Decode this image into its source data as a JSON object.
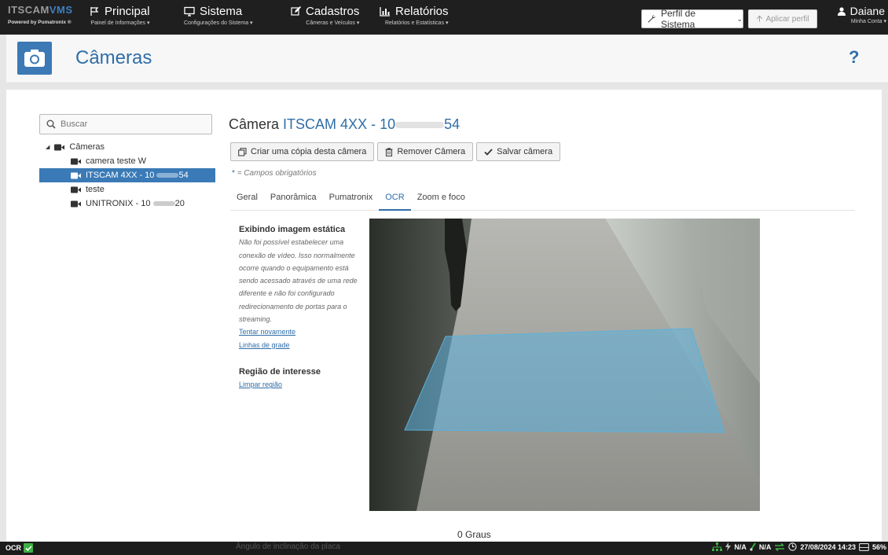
{
  "brand": {
    "logo_text_a": "ITSCAM",
    "logo_text_b": "VMS",
    "powered": "Powered by Pumatronix ®"
  },
  "nav": [
    {
      "label": "Principal",
      "sub": "Painel de Informações ▾",
      "icon": "flag-icon"
    },
    {
      "label": "Sistema",
      "sub": "Configurações do Sistema ▾",
      "icon": "monitor-icon"
    },
    {
      "label": "Cadastros",
      "sub": "Câmeras e Veículos ▾",
      "icon": "edit-icon"
    },
    {
      "label": "Relatórios",
      "sub": "Relatórios e Estatísticas ▾",
      "icon": "bar-chart-icon"
    }
  ],
  "profile": {
    "label": "Perfil de Sistema",
    "apply": "Aplicar perfil"
  },
  "user": {
    "name": "Daiane",
    "sub": "Minha Conta ▾"
  },
  "page": {
    "title": "Câmeras",
    "help": "?"
  },
  "search": {
    "placeholder": "Buscar"
  },
  "tree": {
    "root": "Câmeras",
    "items": [
      {
        "label": "camera teste W"
      },
      {
        "label_a": "ITSCAM 4XX - 10",
        "label_b": "54",
        "selected": true
      },
      {
        "label": "teste"
      },
      {
        "label_a": "UNITRONIX - 10",
        "label_b": "20"
      }
    ]
  },
  "camera": {
    "prefix": "Câmera",
    "name_a": "ITSCAM 4XX - 10",
    "name_b": "54",
    "buttons": {
      "copy": "Criar uma cópia desta câmera",
      "remove": "Remover Câmera",
      "save": "Salvar câmera"
    },
    "required_star": "*",
    "required_text": "= Campos obrigatórios"
  },
  "tabs": [
    "Geral",
    "Panorâmica",
    "Pumatronix",
    "OCR",
    "Zoom e foco"
  ],
  "active_tab": "OCR",
  "info": {
    "head": "Exibindo imagem estática",
    "desc": "Não foi possível estabelecer uma conexão de vídeo. Isso normalmente ocorre quando o equipamento está sendo acessado através de uma rede diferente e não foi configurado redirecionamento de portas para o streaming.",
    "retry": "Tentar novamente",
    "grid": "Linhas de grade",
    "roi_head": "Região de interesse",
    "clear": "Limpar região"
  },
  "degrees": "0 Graus",
  "ghost_label": "Ângulo de inclinação da placa",
  "status": {
    "ocr": "OCR",
    "na1": "N/A",
    "na2": "N/A",
    "datetime": "27/08/2024 14:23",
    "disk": "56%"
  },
  "colors": {
    "accent": "#2f6ea8",
    "selected": "#3a7ab6",
    "roi": "#5bb1dc",
    "ok": "#3cb043"
  }
}
